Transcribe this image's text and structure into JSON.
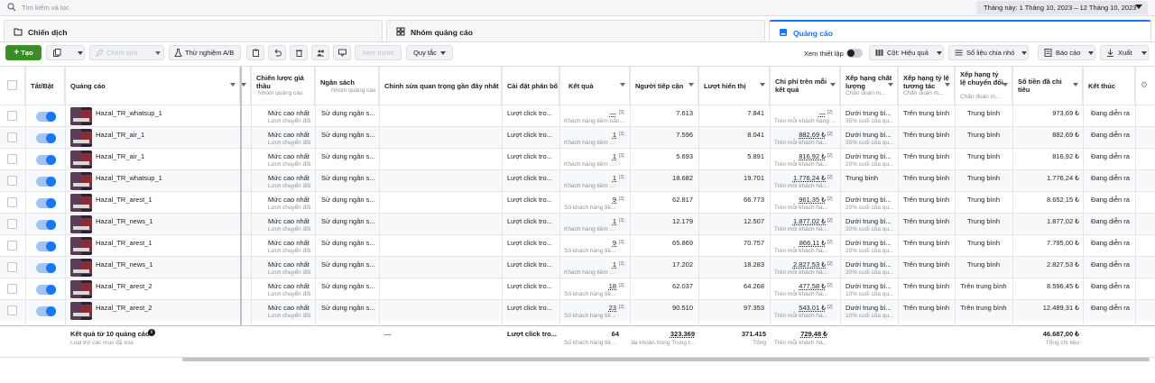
{
  "search": {
    "placeholder": "Tìm kiếm và lọc"
  },
  "date_range": "Tháng này: 1 Tháng 10, 2023 – 12 Tháng 10, 2023",
  "tabs": [
    {
      "label": "Chiến dịch",
      "icon": "folder-icon"
    },
    {
      "label": "Nhóm quảng cáo",
      "icon": "grid-icon"
    },
    {
      "label": "Quảng cáo",
      "icon": "ad-icon"
    }
  ],
  "toolbar": {
    "create": "Tạo",
    "edit": "Chỉnh sửa",
    "ab_test": "Thử nghiệm A/B",
    "preview": "Xem trước",
    "rules": "Quy tắc",
    "view_setup": "Xem thiết lập",
    "columns": "Cột: Hiệu quả",
    "breakdown": "Số liệu chia nhỏ",
    "reports": "Báo cáo",
    "export": "Xuất"
  },
  "columns": {
    "toggle": "Tắt/Bật",
    "ad": "Quảng cáo",
    "bid": "Chiến lược giá thầu",
    "bid_sub": "Nhóm quảng cáo",
    "budget": "Ngân sách",
    "budget_sub": "Nhóm quảng cáo",
    "edits": "Chỉnh sửa quan trọng gần đây nhất",
    "attribution": "Cài đặt phân bổ",
    "results": "Kết quả",
    "reach": "Người tiếp cận",
    "impressions": "Lượt hiển thị",
    "cpr": "Chi phí trên mỗi kết quả",
    "quality": "Xếp hạng chất lượng",
    "quality_sub": "Chẩn đoán m...",
    "engagement": "Xếp hạng tỷ lệ tương tác",
    "engagement_sub": "Chẩn đoán m...",
    "conversion": "Xếp hạng tỷ lệ chuyển đổi",
    "conversion_sub": "Chẩn đoán m...",
    "spent": "Số tiền đã chi tiêu",
    "ends": "Kết thúc"
  },
  "rows": [
    {
      "name": "Hazal_TR_whatsup_1",
      "bid": "Mức cao nhất",
      "bid_sub": "Lượt chuyển đổi",
      "budget": "Sử dụng ngân s...",
      "attribution": "Lượt click tro...",
      "result": "—",
      "result_sub": "Khách hàng tiềm năn...",
      "reach": "7.613",
      "impressions": "7.841",
      "cpr": "—",
      "cpr_sub": "Trên mỗi khách hàng ...",
      "quality": "Dưới trung bì...",
      "quality_sub": "35% cuối của qu...",
      "engagement": "Trên trung bình",
      "conversion": "Trung bình",
      "spent": "973,69 ₺",
      "ends": "Đang diễn ra"
    },
    {
      "name": "Hazal_TR_air_1",
      "bid": "Mức cao nhất",
      "bid_sub": "Lượt chuyển đổi",
      "budget": "Sử dụng ngân s...",
      "attribution": "Lượt click tro...",
      "result": "1",
      "result_sub": "Khách hàng tiềm ...",
      "reach": "7.596",
      "impressions": "8.041",
      "cpr": "882,69 ₺",
      "cpr_sub": "Trên mỗi khách hà...",
      "quality": "Dưới trung bì...",
      "quality_sub": "35% cuối của qu...",
      "engagement": "Trên trung bình",
      "conversion": "Trung bình",
      "spent": "882,69 ₺",
      "ends": "Đang diễn ra"
    },
    {
      "name": "Hazal_TR_air_1",
      "bid": "Mức cao nhất",
      "bid_sub": "Lượt chuyển đổi",
      "budget": "Sử dụng ngân s...",
      "attribution": "Lượt click tro...",
      "result": "1",
      "result_sub": "Khách hàng tiềm ...",
      "reach": "5.693",
      "impressions": "5.891",
      "cpr": "816,92 ₺",
      "cpr_sub": "Trên mỗi khách hà...",
      "quality": "Dưới trung bì...",
      "quality_sub": "20% cuối của qu...",
      "engagement": "Trên trung bình",
      "conversion": "Trung bình",
      "spent": "816,92 ₺",
      "ends": "Đang diễn ra"
    },
    {
      "name": "Hazal_TR_whatsup_1",
      "bid": "Mức cao nhất",
      "bid_sub": "Lượt chuyển đổi",
      "budget": "Sử dụng ngân s...",
      "attribution": "Lượt click tro...",
      "result": "1",
      "result_sub": "Khách hàng tiềm ...",
      "reach": "18.682",
      "impressions": "19.701",
      "cpr": "1.776,24 ₺",
      "cpr_sub": "Trên mỗi khách hà...",
      "quality": "Trung bình",
      "quality_sub": "",
      "engagement": "Trên trung bình",
      "conversion": "Trung bình",
      "spent": "1.776,24 ₺",
      "ends": "Đang diễn ra"
    },
    {
      "name": "Hazal_TR_arest_1",
      "bid": "Mức cao nhất",
      "bid_sub": "Lượt chuyển đổi",
      "budget": "Sử dụng ngân s...",
      "attribution": "Lượt click tro...",
      "result": "9",
      "result_sub": "Số khách hàng tiề...",
      "reach": "62.817",
      "impressions": "66.773",
      "cpr": "961,35 ₺",
      "cpr_sub": "Trên mỗi khách hà...",
      "quality": "Dưới trung bì...",
      "quality_sub": "20% cuối của qu...",
      "engagement": "Trên trung bình",
      "conversion": "Trung bình",
      "spent": "8.652,15 ₺",
      "ends": "Đang diễn ra"
    },
    {
      "name": "Hazal_TR_news_1",
      "bid": "Mức cao nhất",
      "bid_sub": "Lượt chuyển đổi",
      "budget": "Sử dụng ngân s...",
      "attribution": "Lượt click tro...",
      "result": "1",
      "result_sub": "Khách hàng tiềm ...",
      "reach": "12.179",
      "impressions": "12.507",
      "cpr": "1.877,02 ₺",
      "cpr_sub": "Trên mỗi khách hà...",
      "quality": "Dưới trung bì...",
      "quality_sub": "20% cuối của qu...",
      "engagement": "Trên trung bình",
      "conversion": "Trung bình",
      "spent": "1.877,02 ₺",
      "ends": "Đang diễn ra"
    },
    {
      "name": "Hazal_TR_arest_1",
      "bid": "Mức cao nhất",
      "bid_sub": "Lượt chuyển đổi",
      "budget": "Sử dụng ngân s...",
      "attribution": "Lượt click tro...",
      "result": "9",
      "result_sub": "Số khách hàng tiề...",
      "reach": "65.869",
      "impressions": "70.757",
      "cpr": "866,11 ₺",
      "cpr_sub": "Trên mỗi khách hà...",
      "quality": "Dưới trung bì...",
      "quality_sub": "20% cuối của qu...",
      "engagement": "Trên trung bình",
      "conversion": "Trung bình",
      "spent": "7.795,00 ₺",
      "ends": "Đang diễn ra"
    },
    {
      "name": "Hazal_TR_news_1",
      "bid": "Mức cao nhất",
      "bid_sub": "Lượt chuyển đổi",
      "budget": "Sử dụng ngân s...",
      "attribution": "Lượt click tro...",
      "result": "1",
      "result_sub": "Khách hàng tiềm ...",
      "reach": "17.202",
      "impressions": "18.283",
      "cpr": "2.827,53 ₺",
      "cpr_sub": "Trên mỗi khách hà...",
      "quality": "Dưới trung bì...",
      "quality_sub": "20% cuối của qu...",
      "engagement": "Trên trung bình",
      "conversion": "Trung bình",
      "spent": "2.827,53 ₺",
      "ends": "Đang diễn ra"
    },
    {
      "name": "Hazal_TR_arest_2",
      "bid": "Mức cao nhất",
      "bid_sub": "Lượt chuyển đổi",
      "budget": "Sử dụng ngân s...",
      "attribution": "Lượt click tro...",
      "result": "18",
      "result_sub": "Số khách hàng tiề...",
      "reach": "62.037",
      "impressions": "64.268",
      "cpr": "477,58 ₺",
      "cpr_sub": "Trên mỗi khách hà...",
      "quality": "Dưới trung bì...",
      "quality_sub": "10% cuối của qu...",
      "engagement": "Trên trung bình",
      "conversion": "Trên trung bình",
      "spent": "8.596,45 ₺",
      "ends": "Đang diễn ra"
    },
    {
      "name": "Hazal_TR_arest_2",
      "bid": "Mức cao nhất",
      "bid_sub": "Lượt chuyển đổi",
      "budget": "Sử dụng ngân s...",
      "attribution": "Lượt click tro...",
      "result": "23",
      "result_sub": "Số khách hàng tiề...",
      "reach": "90.510",
      "impressions": "97.353",
      "cpr": "543,01 ₺",
      "cpr_sub": "Trên mỗi khách hà...",
      "quality": "Dưới trung bì...",
      "quality_sub": "10% cuối của qu...",
      "engagement": "Trên trung bình",
      "conversion": "Trên trung bình",
      "spent": "12.489,31 ₺",
      "ends": "Đang diễn ra"
    }
  ],
  "footer": {
    "label": "Kết quả từ 10 quảng cáo",
    "sub": "Loại trừ các mục đã xóa",
    "edits": "—",
    "attribution": "Lượt click tro...",
    "results": "64",
    "results_sub": "Số khách hàng tiề...",
    "reach": "323.369",
    "reach_sub": "tài khoản trong Trung t...",
    "impressions": "371.415",
    "impressions_sub": "Tổng",
    "cpr": "729,48 ₺",
    "cpr_sub": "Trên mỗi khách hà...",
    "spent": "46.687,00 ₺",
    "spent_sub": "Tổng chi tiêu"
  },
  "colors": {
    "accent": "#1877f2",
    "create_green": "#3b8b27",
    "toggle_on": "#1877f2"
  }
}
